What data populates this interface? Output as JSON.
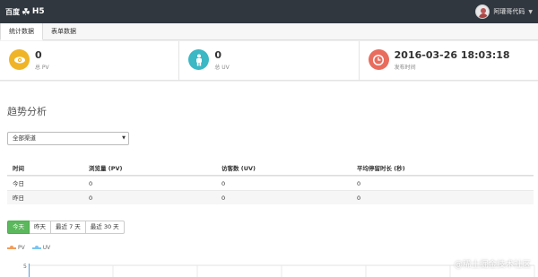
{
  "header": {
    "logo_text": "百度",
    "logo_suffix": "H5",
    "user_name": "阿瓘哥代码",
    "background_color": "#30373f"
  },
  "tabs": [
    {
      "label": "统计数据",
      "active": true
    },
    {
      "label": "表单数据",
      "active": false
    }
  ],
  "stats": [
    {
      "value": "0",
      "label": "总 PV",
      "icon": "eye-icon",
      "color": "#f0b429"
    },
    {
      "value": "0",
      "label": "总 UV",
      "icon": "person-icon",
      "color": "#3cb7c4"
    },
    {
      "value": "2016-03-26 18:03:18",
      "label": "发布时间",
      "icon": "clock-icon",
      "color": "#e86d5e"
    }
  ],
  "trend": {
    "title": "趋势分析",
    "channel_select": {
      "selected": "全部渠道"
    },
    "table": {
      "headers": [
        "时间",
        "浏览量 (PV)",
        "访客数 (UV)",
        "平均停留时长 (秒)"
      ],
      "rows": [
        [
          "今日",
          "0",
          "0",
          "0"
        ],
        [
          "昨日",
          "0",
          "0",
          "0"
        ]
      ]
    },
    "ranges": [
      {
        "label": "今天",
        "active": true
      },
      {
        "label": "昨天",
        "active": false
      },
      {
        "label": "最近 7 天",
        "active": false
      },
      {
        "label": "最近 30 天",
        "active": false
      }
    ],
    "legend": [
      {
        "label": "PV",
        "color": "#f39c5a"
      },
      {
        "label": "UV",
        "color": "#7cc4f0"
      }
    ],
    "chart_y_tick": "5"
  },
  "chart_data": {
    "type": "line",
    "title": "",
    "xlabel": "",
    "ylabel": "",
    "series": [
      {
        "name": "PV",
        "values": []
      },
      {
        "name": "UV",
        "values": []
      }
    ],
    "y_ticks": [
      "5"
    ],
    "grid": true
  },
  "watermark": "@稀土掘金技术社区"
}
